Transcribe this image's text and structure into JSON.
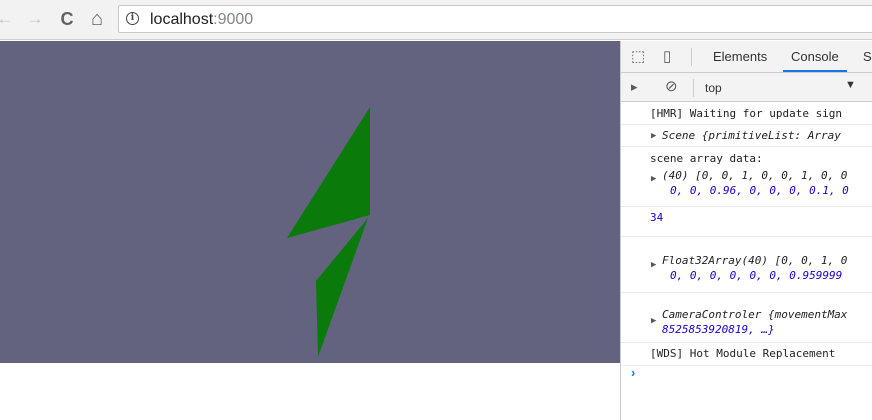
{
  "browser": {
    "back_glyph": "←",
    "forward_glyph": "→",
    "reload_glyph": "C",
    "home_glyph": "⌂",
    "info_glyph": "i",
    "url_host": "localhost",
    "url_port": ":9000"
  },
  "devtools": {
    "tabs": [
      "Elements",
      "Console",
      "Sc"
    ],
    "context": "top",
    "console_lines": {
      "l1": "[HMR] Waiting for update sign",
      "l2_name": "Scene",
      "l2_body": "{primitiveList: Array",
      "l3": "scene array data:",
      "l4_a": "(40) [0, 0, 1, 0, 0, 1, 0, 0",
      "l4_b": "0, 0, 0.96, 0, 0, 0, 0.1, 0",
      "l5": "34",
      "l6_a": "Float32Array(40) [0, 0, 1, 0",
      "l6_b": "0, 0, 0, 0, 0, 0, 0.959999",
      "l7_a": "CameraControler {movementMax",
      "l7_b": "8525853920819, …}",
      "l8": "[WDS] Hot Module Replacement"
    },
    "prompt_glyph": "›"
  },
  "scene": {
    "background_color": "#63637f",
    "shape_color": "#0a7a0a"
  }
}
